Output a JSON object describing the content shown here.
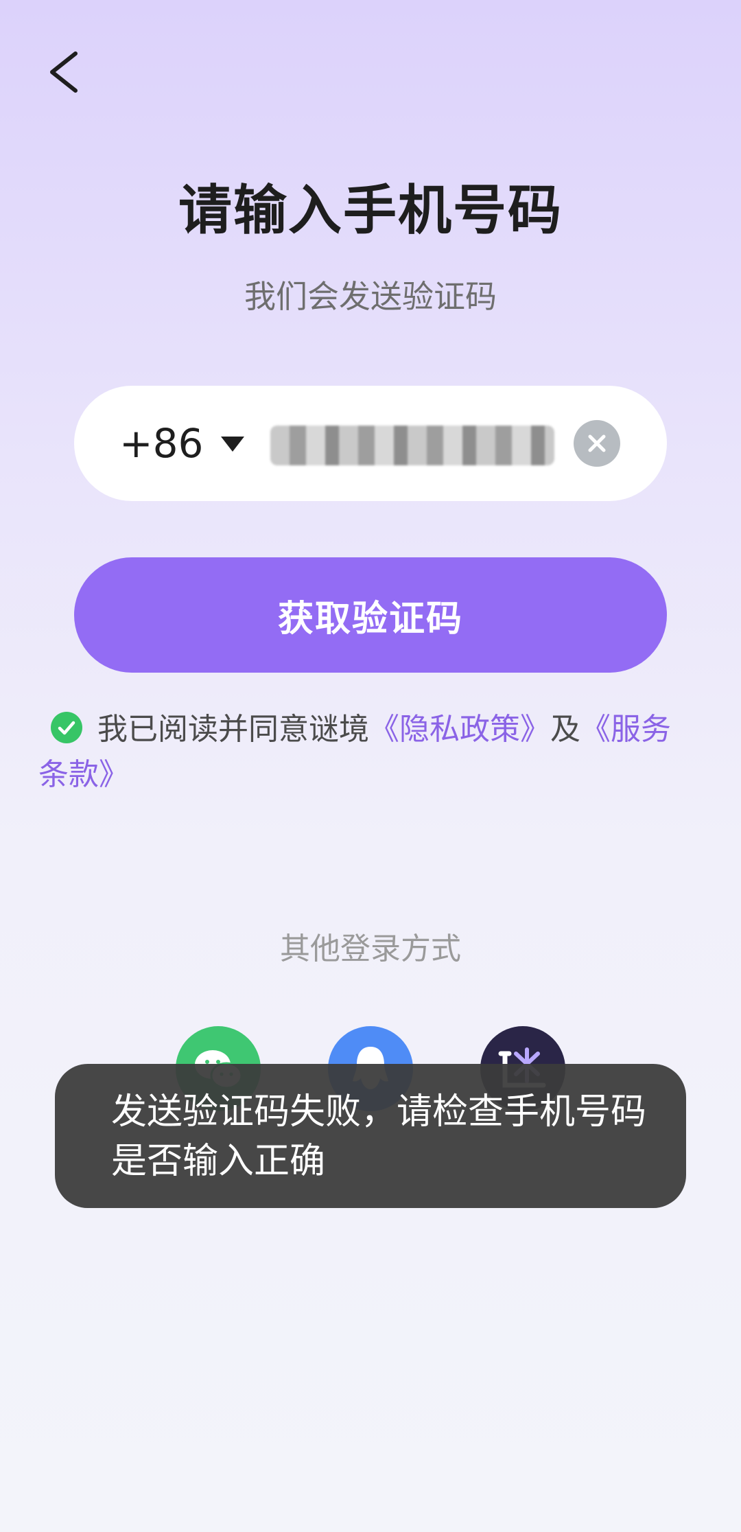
{
  "header": {
    "back_icon": "chevron-left-icon"
  },
  "title": "请输入手机号码",
  "subtitle": "我们会发送验证码",
  "phone": {
    "country_code": "+86",
    "dropdown_icon": "caret-down-icon",
    "value": "",
    "clear_icon": "clear-icon"
  },
  "get_code_button": "获取验证码",
  "agreement": {
    "checked": true,
    "text": "我已阅读并同意谜境",
    "privacy_link": "《隐私政策》",
    "and": "及",
    "terms_link": "《服务条款》"
  },
  "other_login": {
    "label": "其他登录方式",
    "methods": [
      {
        "name": "wechat",
        "icon": "wechat-icon",
        "color": "#3fc772"
      },
      {
        "name": "qq",
        "icon": "qq-icon",
        "color": "#4f8cf6"
      },
      {
        "name": "mijing",
        "icon": "mijing-icon",
        "color": "#2a2547"
      }
    ]
  },
  "toast": {
    "message": "发送验证码失败，请检查手机号码是否输入正确"
  },
  "colors": {
    "accent": "#936cf4",
    "check": "#37c566",
    "link": "#8a63e6"
  }
}
